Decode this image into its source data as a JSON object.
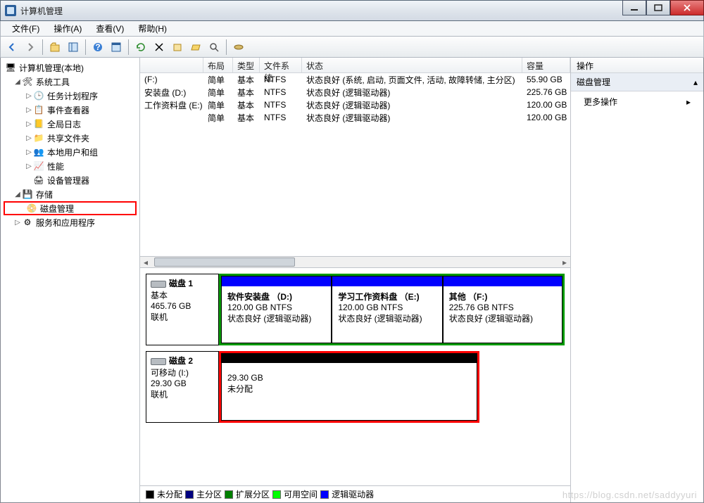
{
  "window": {
    "title": "计算机管理"
  },
  "menu": {
    "file": "文件(F)",
    "action": "操作(A)",
    "view": "查看(V)",
    "help": "帮助(H)"
  },
  "tree": {
    "root": "计算机管理(本地)",
    "system_tools": "系统工具",
    "task_scheduler": "任务计划程序",
    "event_viewer": "事件查看器",
    "global_logs": "全局日志",
    "shared_folders": "共享文件夹",
    "local_users": "本地用户和组",
    "performance": "性能",
    "device_manager": "设备管理器",
    "storage": "存储",
    "disk_management": "磁盘管理",
    "services_apps": "服务和应用程序"
  },
  "vol_headers": {
    "layout": "布局",
    "type": "类型",
    "fs": "文件系统",
    "status": "状态",
    "capacity": "容量"
  },
  "volumes": [
    {
      "name": "(F:)",
      "layout": "简单",
      "type": "基本",
      "fs": "NTFS",
      "status": "状态良好 (系统, 启动, 页面文件, 活动, 故障转储, 主分区)",
      "capacity": "55.90 GB"
    },
    {
      "name": "安装盘 (D:)",
      "layout": "简单",
      "type": "基本",
      "fs": "NTFS",
      "status": "状态良好 (逻辑驱动器)",
      "capacity": "225.76 GB"
    },
    {
      "name": "工作资料盘 (E:)",
      "layout": "简单",
      "type": "基本",
      "fs": "NTFS",
      "status": "状态良好 (逻辑驱动器)",
      "capacity": "120.00 GB"
    },
    {
      "name": "",
      "layout": "简单",
      "type": "基本",
      "fs": "NTFS",
      "status": "状态良好 (逻辑驱动器)",
      "capacity": "120.00 GB"
    }
  ],
  "disks": {
    "disk1": {
      "name": "磁盘 1",
      "type": "基本",
      "size": "465.76 GB",
      "state": "联机"
    },
    "disk2": {
      "name": "磁盘 2",
      "type": "可移动 (I:)",
      "size": "29.30 GB",
      "state": "联机"
    }
  },
  "parts": {
    "d": {
      "title": "软件安装盘 （D:)",
      "info": "120.00 GB NTFS",
      "status": "状态良好 (逻辑驱动器)"
    },
    "e": {
      "title": "学习工作资料盘 （E:)",
      "info": "120.00 GB NTFS",
      "status": "状态良好 (逻辑驱动器)"
    },
    "f": {
      "title": "其他 （F:)",
      "info": "225.76 GB NTFS",
      "status": "状态良好 (逻辑驱动器)"
    },
    "i": {
      "size": "29.30 GB",
      "status": "未分配"
    }
  },
  "legend": {
    "unallocated": "未分配",
    "primary": "主分区",
    "extended": "扩展分区",
    "free": "可用空间",
    "logical": "逻辑驱动器"
  },
  "actions": {
    "header": "操作",
    "section": "磁盘管理",
    "more": "更多操作"
  },
  "watermark": "https://blog.csdn.net/saddyyuri"
}
